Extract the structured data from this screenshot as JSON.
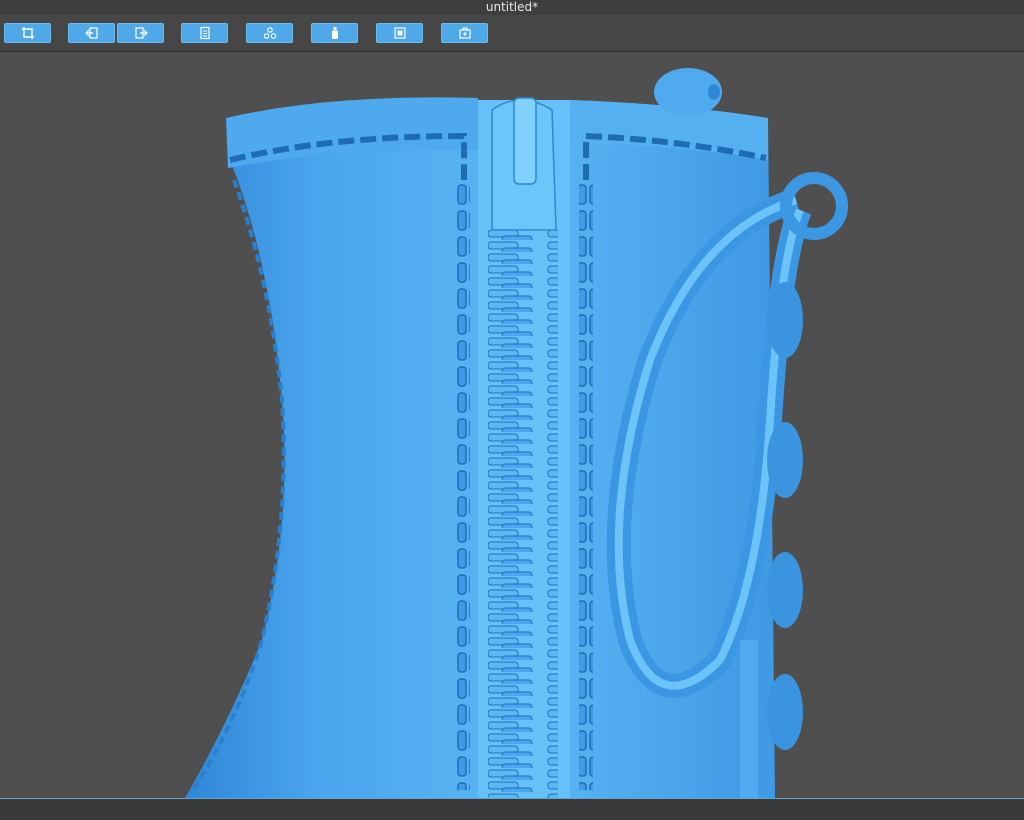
{
  "window": {
    "title": "untitled*"
  },
  "toolbar": {
    "buttons": [
      {
        "name": "crop-button",
        "icon": "crop-icon"
      },
      {
        "name": "import-button",
        "icon": "import-icon"
      },
      {
        "name": "export-button",
        "icon": "export-icon"
      },
      {
        "name": "document-button",
        "icon": "document-icon"
      },
      {
        "name": "components-button",
        "icon": "components-icon"
      },
      {
        "name": "bottle-button",
        "icon": "bottle-icon"
      },
      {
        "name": "solid-button",
        "icon": "solid-icon"
      },
      {
        "name": "add-box-button",
        "icon": "add-box-icon"
      }
    ]
  },
  "viewport": {
    "object": "3d-boot-model",
    "colors": {
      "model": "#4aa6ee",
      "background": "#4f4f4f",
      "accent": "#4fa8e8"
    }
  }
}
